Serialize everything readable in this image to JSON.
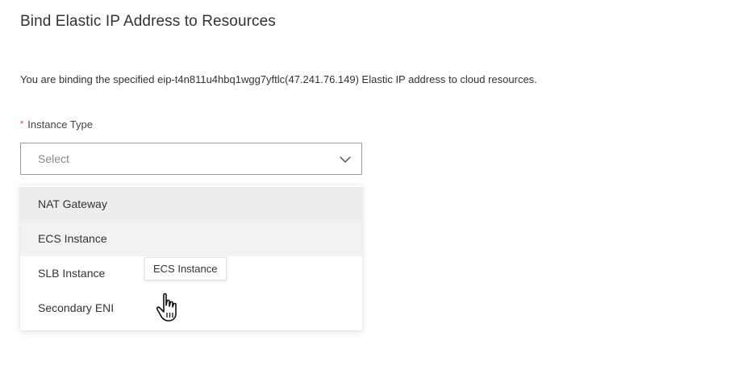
{
  "dialog": {
    "title": "Bind Elastic IP Address to Resources",
    "description": "You are binding the specified eip-t4n811u4hbq1wgg7yftlc(47.241.76.149) Elastic IP address to cloud resources."
  },
  "instance_type": {
    "required_marker": "*",
    "label": "Instance Type",
    "placeholder": "Select",
    "icon": "chevron-down-icon",
    "options": [
      {
        "label": "NAT Gateway"
      },
      {
        "label": "ECS Instance"
      },
      {
        "label": "SLB Instance"
      },
      {
        "label": "Secondary ENI"
      }
    ],
    "hovered_option": "ECS Instance"
  },
  "tooltip": {
    "text": "ECS Instance"
  },
  "cursor": {
    "icon": "hand-pointer-icon"
  },
  "colors": {
    "required": "#e0402e",
    "text": "#333333",
    "placeholder": "#888888",
    "border": "#9a9a9a",
    "hover_bg": "#ededed"
  }
}
